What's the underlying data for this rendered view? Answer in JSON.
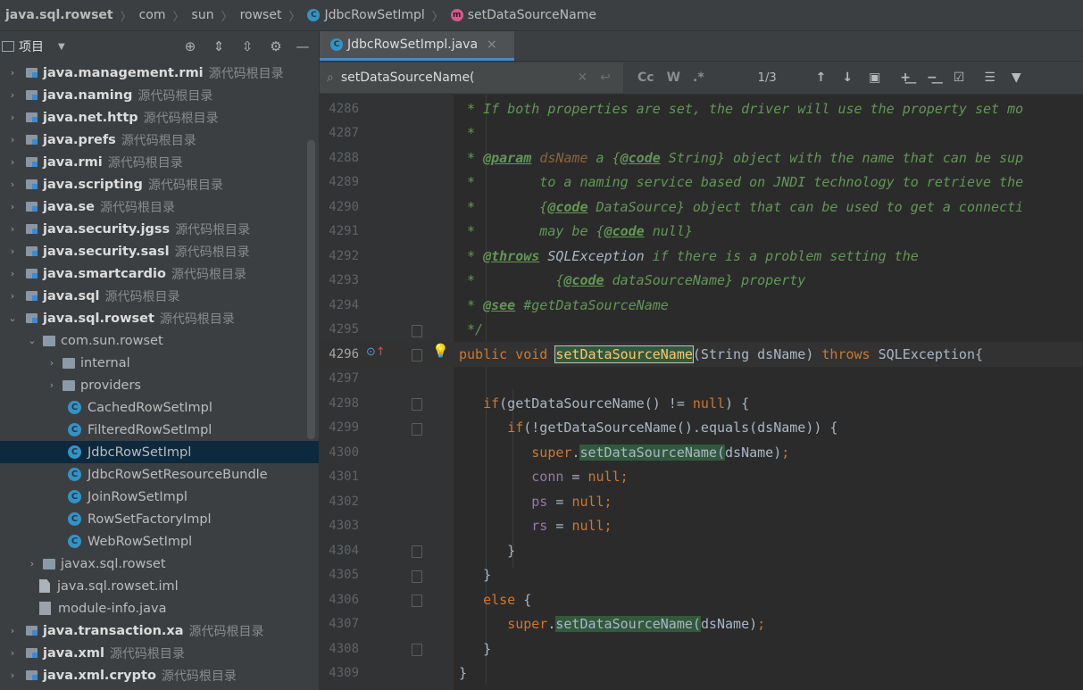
{
  "breadcrumb": [
    "java.sql.rowset",
    "com",
    "sun",
    "rowset",
    "JdbcRowSetImpl",
    "setDataSourceName"
  ],
  "project_panel": {
    "title": "项目",
    "tool_icons": [
      "locate-icon",
      "expand-all-icon",
      "collapse-all-icon",
      "gear-icon",
      "minimize-icon"
    ]
  },
  "source_root_label": "源代码根目录",
  "tree": [
    {
      "name": "java.management.rmi",
      "kind": "module",
      "root": true,
      "arrow": "›",
      "indent": 0
    },
    {
      "name": "java.naming",
      "kind": "module",
      "root": true,
      "arrow": "›",
      "indent": 0
    },
    {
      "name": "java.net.http",
      "kind": "module",
      "root": true,
      "arrow": "›",
      "indent": 0
    },
    {
      "name": "java.prefs",
      "kind": "module",
      "root": true,
      "arrow": "›",
      "indent": 0
    },
    {
      "name": "java.rmi",
      "kind": "module",
      "root": true,
      "arrow": "›",
      "indent": 0
    },
    {
      "name": "java.scripting",
      "kind": "module",
      "root": true,
      "arrow": "›",
      "indent": 0
    },
    {
      "name": "java.se",
      "kind": "module",
      "root": true,
      "arrow": "›",
      "indent": 0
    },
    {
      "name": "java.security.jgss",
      "kind": "module",
      "root": true,
      "arrow": "›",
      "indent": 0
    },
    {
      "name": "java.security.sasl",
      "kind": "module",
      "root": true,
      "arrow": "›",
      "indent": 0
    },
    {
      "name": "java.smartcardio",
      "kind": "module",
      "root": true,
      "arrow": "›",
      "indent": 0
    },
    {
      "name": "java.sql",
      "kind": "module",
      "root": true,
      "arrow": "›",
      "indent": 0
    },
    {
      "name": "java.sql.rowset",
      "kind": "module",
      "root": true,
      "arrow": "⌄",
      "indent": 0
    },
    {
      "name": "com.sun.rowset",
      "kind": "package",
      "root": false,
      "arrow": "⌄",
      "indent": 1
    },
    {
      "name": "internal",
      "kind": "package",
      "root": false,
      "arrow": "›",
      "indent": 2
    },
    {
      "name": "providers",
      "kind": "package",
      "root": false,
      "arrow": "›",
      "indent": 2
    },
    {
      "name": "CachedRowSetImpl",
      "kind": "class",
      "root": false,
      "arrow": "",
      "indent": 3
    },
    {
      "name": "FilteredRowSetImpl",
      "kind": "class",
      "root": false,
      "arrow": "",
      "indent": 3
    },
    {
      "name": "JdbcRowSetImpl",
      "kind": "class",
      "root": false,
      "arrow": "",
      "indent": 3,
      "selected": true
    },
    {
      "name": "JdbcRowSetResourceBundle",
      "kind": "class",
      "root": false,
      "arrow": "",
      "indent": 3
    },
    {
      "name": "JoinRowSetImpl",
      "kind": "class",
      "root": false,
      "arrow": "",
      "indent": 3
    },
    {
      "name": "RowSetFactoryImpl",
      "kind": "class",
      "root": false,
      "arrow": "",
      "indent": 3
    },
    {
      "name": "WebRowSetImpl",
      "kind": "class",
      "root": false,
      "arrow": "",
      "indent": 3
    },
    {
      "name": "javax.sql.rowset",
      "kind": "package",
      "root": false,
      "arrow": "›",
      "indent": 1
    },
    {
      "name": "java.sql.rowset.iml",
      "kind": "file",
      "root": false,
      "arrow": "",
      "indent": 1
    },
    {
      "name": "module-info.java",
      "kind": "java",
      "root": false,
      "arrow": "",
      "indent": 1
    },
    {
      "name": "java.transaction.xa",
      "kind": "module",
      "root": true,
      "arrow": "›",
      "indent": 0
    },
    {
      "name": "java.xml",
      "kind": "module",
      "root": true,
      "arrow": "›",
      "indent": 0
    },
    {
      "name": "java.xml.crypto",
      "kind": "module",
      "root": true,
      "arrow": "›",
      "indent": 0
    }
  ],
  "editor_tab": {
    "label": "JdbcRowSetImpl.java",
    "close": "×"
  },
  "find": {
    "query": "setDataSourceName(",
    "match_count": "1/3",
    "case_label": "Cc",
    "word_label": "W",
    "regex_label": ".*"
  },
  "code_lines": [
    {
      "n": "4286",
      "html": "<span class='cm'> * If both properties are set, the driver will use the property set mo</span>"
    },
    {
      "n": "4287",
      "html": "<span class='cm'> *</span>"
    },
    {
      "n": "4288",
      "html": "<span class='cm'> * </span><span class='tag'>@param</span><span class='cm'> </span><span class='pn'>dsName</span><span class='cm'> a {</span><span class='tag'>@code</span><span class='cm'> String} object with the name that can be sup</span>"
    },
    {
      "n": "4289",
      "html": "<span class='cm'> *        to a naming service based on JNDI technology to retrieve the</span>"
    },
    {
      "n": "4290",
      "html": "<span class='cm'> *        {</span><span class='tag'>@code</span><span class='cm'> DataSource} object that can be used to get a connecti</span>"
    },
    {
      "n": "4291",
      "html": "<span class='cm'> *        may be {</span><span class='tag'>@code</span><span class='cm'> null}</span>"
    },
    {
      "n": "4292",
      "html": "<span class='cm'> * </span><span class='tag'>@throws</span><span class='cm'> </span><span class='plain' style='font-style:italic'>SQLException</span><span class='cm'> if there is a problem setting the</span>"
    },
    {
      "n": "4293",
      "html": "<span class='cm'> *          {</span><span class='tag'>@code</span><span class='cm'> dataSourceName} property</span>"
    },
    {
      "n": "4294",
      "html": "<span class='cm'> * </span><span class='tag'>@see</span><span class='cm'> #getDataSourceName</span>"
    },
    {
      "n": "4295",
      "html": "<span class='cm'> */</span>"
    },
    {
      "n": "4296",
      "html": "<span class='k'>public void </span><span class='fn hl-box'>setDataSourceName</span><span class='plain'>(String dsName) </span><span class='k'>throws </span><span class='plain'>SQLException{</span>",
      "active": true
    },
    {
      "n": "4297",
      "html": ""
    },
    {
      "n": "4298",
      "html": "<span class='plain'>   </span><span class='k'>if</span><span class='plain'>(getDataSourceName() != </span><span class='k'>null</span><span class='plain'>) {</span>"
    },
    {
      "n": "4299",
      "html": "<span class='plain'>      </span><span class='k'>if</span><span class='plain'>(!getDataSourceName().equals(dsName)) {</span>"
    },
    {
      "n": "4300",
      "html": "<span class='plain'>         </span><span class='k'>super</span><span class='plain'>.</span><span class='plain hl'>setDataSourceName(</span><span class='plain'>dsName)</span><span class='k'>;</span>"
    },
    {
      "n": "4301",
      "html": "<span class='plain'>         </span><span class='fld'>conn</span><span class='plain'> = </span><span class='k'>null;</span>"
    },
    {
      "n": "4302",
      "html": "<span class='plain'>         </span><span class='fld'>ps</span><span class='plain'> = </span><span class='k'>null;</span>"
    },
    {
      "n": "4303",
      "html": "<span class='plain'>         </span><span class='fld'>rs</span><span class='plain'> = </span><span class='k'>null;</span>"
    },
    {
      "n": "4304",
      "html": "<span class='plain'>      }</span>"
    },
    {
      "n": "4305",
      "html": "<span class='plain'>   }</span>"
    },
    {
      "n": "4306",
      "html": "<span class='plain'>   </span><span class='k'>else</span><span class='plain'> {</span>"
    },
    {
      "n": "4307",
      "html": "<span class='plain'>      </span><span class='k'>super</span><span class='plain'>.</span><span class='plain hl'>setDataSourceName(</span><span class='plain'>dsName)</span><span class='k'>;</span>"
    },
    {
      "n": "4308",
      "html": "<span class='plain'>   }</span>"
    },
    {
      "n": "4309",
      "html": "<span class='plain'>}</span>"
    }
  ]
}
